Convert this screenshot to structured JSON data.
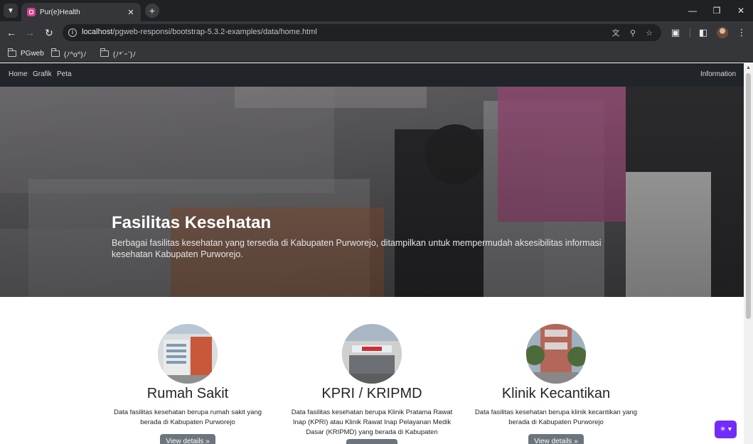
{
  "browser": {
    "tab_title": "Pur(e)Health",
    "tab_close": "✕",
    "new_tab": "+",
    "url_host": "localhost",
    "url_path": "/pgweb-responsi/bootstrap-5.3.2-examples/data/home.html",
    "bookmarks": [
      {
        "label": "PGweb"
      },
      {
        "label": "(ﾉ^o^)ﾉ"
      },
      {
        "label": "(ﾉ*´ｰ`)ﾉ"
      }
    ]
  },
  "navbar": {
    "links": [
      "Home",
      "Grafik",
      "Peta"
    ],
    "right_link": "Information"
  },
  "hero": {
    "title": "Fasilitas Kesehatan",
    "text": "Berbagai fasilitas kesehatan yang tersedia di Kabupaten Purworejo, ditampilkan untuk mempermudah aksesibilitas informasi kesehatan Kabupaten Purworejo."
  },
  "cards": [
    {
      "title": "Rumah Sakit",
      "text": "Data fasilitas kesehatan berupa rumah sakit yang berada di Kabupaten Purworejo",
      "button": "View details »"
    },
    {
      "title": "KPRI / KRIPMD",
      "text": "Data fasilitas kesehatan berupa Klinik Pratama Rawat Inap (KPRI) atau Klinik Rawat Inap Pelayanan Medik Dasar (KRIPMD) yang berada di Kabupaten Purworejo",
      "button": "View details »"
    },
    {
      "title": "Klinik Kecantikan",
      "text": "Data fasilitas kesehatan berupa klinik kecantikan yang berada di Kabupaten Purworejo",
      "button": "View details »"
    }
  ],
  "theme_toggle": {
    "icon": "sun-icon",
    "label": "☀ ▾"
  },
  "colors": {
    "navbar_bg": "#212529",
    "button_bg": "#6c757d",
    "theme_toggle_bg": "#712cf9",
    "tab_favicon": "#d8408e"
  }
}
